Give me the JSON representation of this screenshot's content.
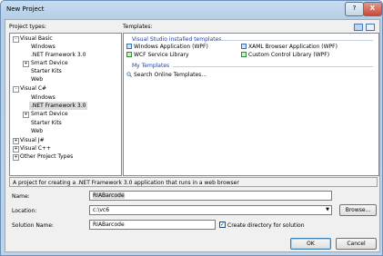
{
  "window": {
    "title": "New Project",
    "help_label": "?",
    "close_label": "X"
  },
  "project_types": {
    "label": "Project types:",
    "items": [
      {
        "label": "Visual Basic",
        "expander": "-"
      },
      {
        "label": "Windows"
      },
      {
        "label": ".NET Framework 3.0"
      },
      {
        "label": "Smart Device",
        "expander": "+"
      },
      {
        "label": "Starter Kits"
      },
      {
        "label": "Web"
      },
      {
        "label": "Visual C#",
        "expander": "-"
      },
      {
        "label": "Windows"
      },
      {
        "label": ".NET Framework 3.0"
      },
      {
        "label": "Smart Device",
        "expander": "+"
      },
      {
        "label": "Starter Kits"
      },
      {
        "label": "Web"
      },
      {
        "label": "Visual J#",
        "expander": "+"
      },
      {
        "label": "Visual C++",
        "expander": "+"
      },
      {
        "label": "Other Project Types",
        "expander": "+"
      }
    ]
  },
  "templates": {
    "label": "Templates:",
    "installed_header": "Visual Studio installed templates",
    "installed": [
      {
        "label": "Windows Application (WPF)",
        "icon": "window-app-icon"
      },
      {
        "label": "XAML Browser Application (WPF)",
        "icon": "browser-app-icon"
      },
      {
        "label": "WCF Service Library",
        "icon": "service-library-icon"
      },
      {
        "label": "Custom Control Library (WPF)",
        "icon": "control-library-icon"
      }
    ],
    "my_header": "My Templates",
    "search_label": "Search Online Templates..."
  },
  "description": "A project for creating a .NET Framework 3.0 application that runs in a web browser",
  "form": {
    "name_label": "Name:",
    "name_value": "RIABarcode",
    "location_label": "Location:",
    "location_value": "c:\\vc6",
    "solution_label": "Solution Name:",
    "solution_value": "RIABarcode",
    "create_dir_label": "Create directory for solution",
    "create_dir_checked": true
  },
  "buttons": {
    "browse": "Browse...",
    "ok": "OK",
    "cancel": "Cancel"
  }
}
